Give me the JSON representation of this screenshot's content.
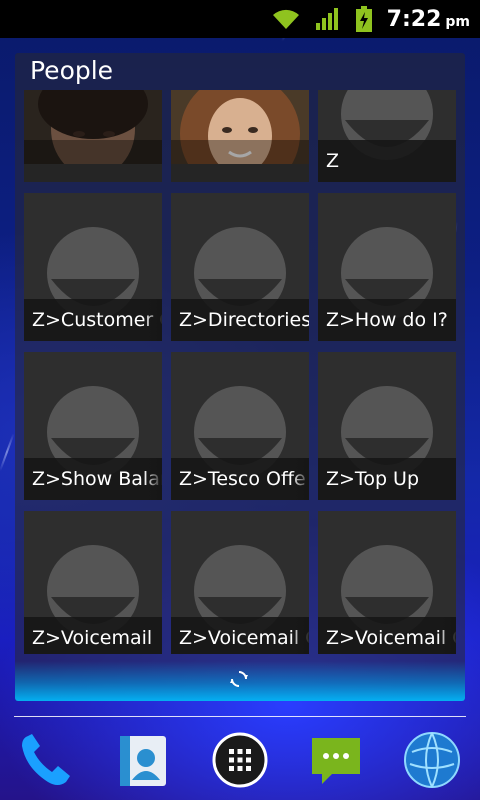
{
  "status_bar": {
    "time": "7:22",
    "ampm": "pm",
    "icons": [
      "wifi-icon",
      "signal-icon",
      "battery-charging-icon"
    ]
  },
  "widget": {
    "title": "People",
    "contacts": [
      {
        "label": "",
        "type": "photo"
      },
      {
        "label": "",
        "type": "photo"
      },
      {
        "label": "Z",
        "type": "placeholder"
      },
      {
        "label": "Z>Customer C",
        "type": "placeholder"
      },
      {
        "label": "Z>Directories",
        "type": "placeholder"
      },
      {
        "label": "Z>How do I?",
        "type": "placeholder"
      },
      {
        "label": "Z>Show Balan",
        "type": "placeholder"
      },
      {
        "label": "Z>Tesco Offe",
        "type": "placeholder"
      },
      {
        "label": "Z>Top Up",
        "type": "placeholder"
      },
      {
        "label": "Z>Voicemail",
        "type": "placeholder"
      },
      {
        "label": "Z>Voicemail C",
        "type": "placeholder"
      },
      {
        "label": "Z>Voicemail C",
        "type": "placeholder"
      }
    ],
    "refresh_icon": "refresh-icon"
  },
  "dock": {
    "items": [
      "phone-icon",
      "contacts-icon",
      "app-drawer-icon",
      "messaging-icon",
      "browser-icon"
    ]
  },
  "colors": {
    "accent_green": "#8fc31f",
    "wifi_green": "#8fc31f",
    "widget_footer_glow": "#00beff"
  }
}
